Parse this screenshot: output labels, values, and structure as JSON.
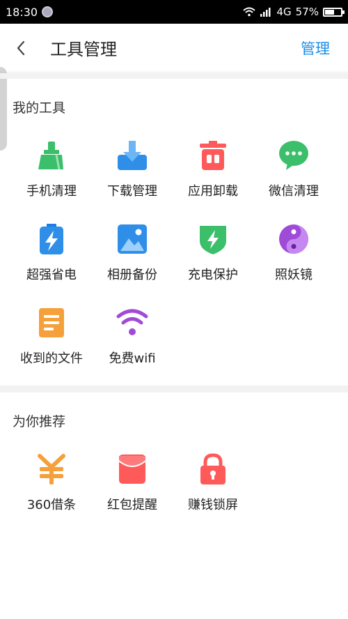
{
  "status": {
    "time": "18:30",
    "network": "4G",
    "battery": "57%",
    "battery_level": 0.57
  },
  "header": {
    "title": "工具管理",
    "manage_label": "管理"
  },
  "my_tools": {
    "title": "我的工具",
    "items": [
      {
        "label": "手机清理",
        "icon": "broom-icon"
      },
      {
        "label": "下载管理",
        "icon": "download-icon"
      },
      {
        "label": "应用卸载",
        "icon": "trash-icon"
      },
      {
        "label": "微信清理",
        "icon": "wechat-icon"
      },
      {
        "label": "超强省电",
        "icon": "battery-bolt-icon"
      },
      {
        "label": "相册备份",
        "icon": "photo-icon"
      },
      {
        "label": "充电保护",
        "icon": "charge-shield-icon"
      },
      {
        "label": "照妖镜",
        "icon": "yin-yang-icon"
      },
      {
        "label": "收到的文件",
        "icon": "file-icon"
      },
      {
        "label": "免费wifi",
        "icon": "wifi-icon"
      }
    ]
  },
  "recommend": {
    "title": "为你推荐",
    "items": [
      {
        "label": "360借条",
        "icon": "yuan-icon"
      },
      {
        "label": "红包提醒",
        "icon": "red-envelope-icon"
      },
      {
        "label": "赚钱锁屏",
        "icon": "lock-icon"
      }
    ]
  },
  "colors": {
    "accent": "#1a8fe8",
    "green": "#3bbf6a",
    "blue": "#2f8ee8",
    "red": "#ff5a5a",
    "purple": "#a04ad8",
    "orange": "#f5a03a"
  }
}
